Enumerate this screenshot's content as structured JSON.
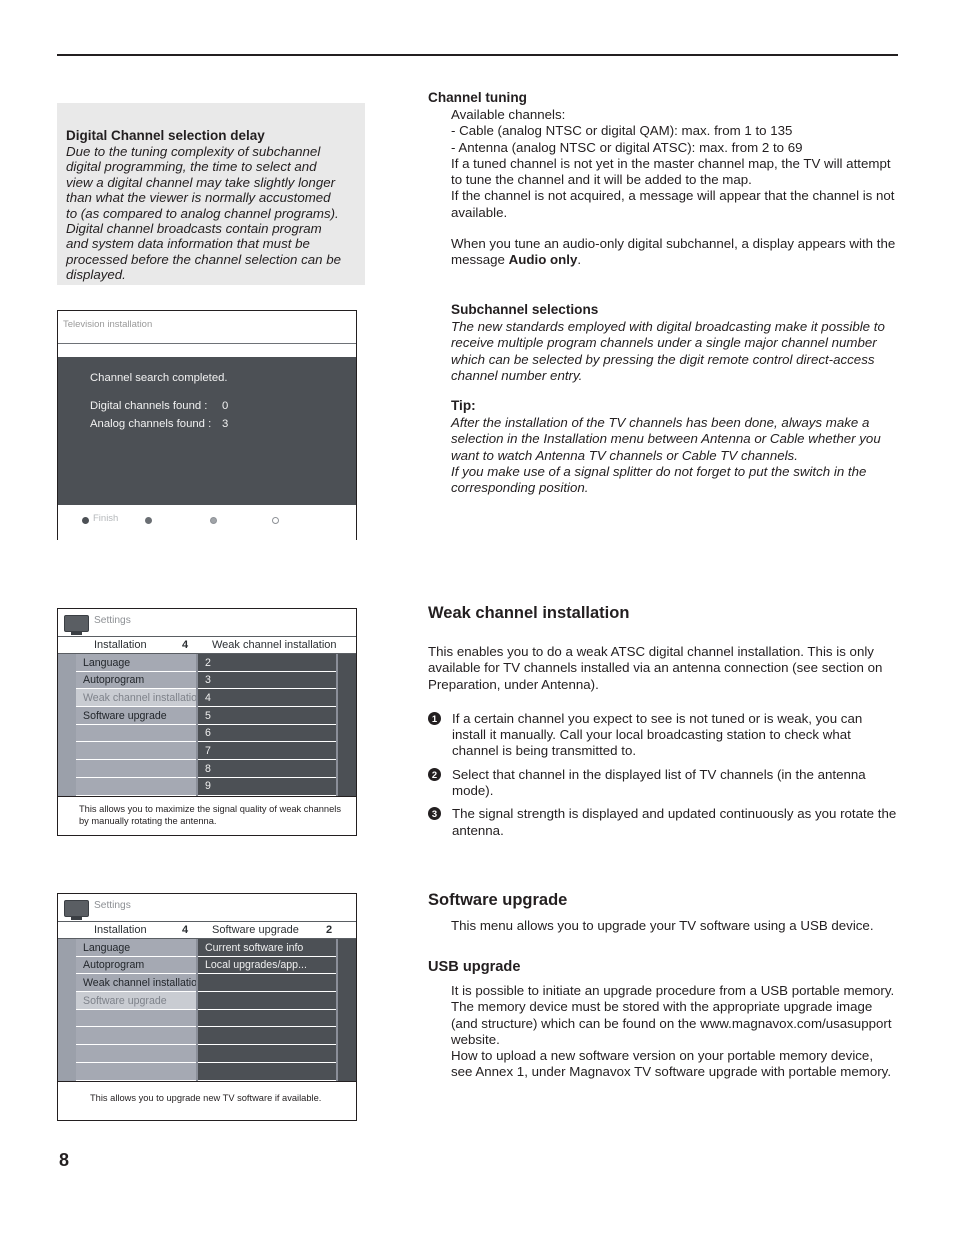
{
  "page": {
    "number": "8"
  },
  "note_box": {
    "title": "Digital Channel selection delay",
    "body": "Due to the tuning complexity of subchannel digital programming, the time to select and view a digital channel may take slightly longer than what the viewer is normally accustomed to (as compared to analog channel programs).\nDigital channel broadcasts contain program and system data information that must be processed before the channel selection can be displayed."
  },
  "illustration_search": {
    "title": "Television installation",
    "message": "Channel search completed.",
    "rows": [
      {
        "label": "Digital channels found :",
        "value": "0"
      },
      {
        "label": "Analog channels found :",
        "value": "3"
      }
    ],
    "footer_label": "Finish"
  },
  "illustration_weak": {
    "settings_label": "Settings",
    "header_left": "Installation",
    "header_left_num": "4",
    "header_right": "Weak channel installation",
    "header_right_num": "",
    "left_items": [
      "Language",
      "Autoprogram",
      "Weak channel installation",
      "Software upgrade",
      "",
      "",
      "",
      ""
    ],
    "selected_left_index": 2,
    "right_items": [
      "2",
      "3",
      "4",
      "5",
      "6",
      "7",
      "8",
      "9"
    ],
    "description": "This allows you to maximize the signal quality of weak channels by manually rotating the antenna."
  },
  "illustration_software": {
    "settings_label": "Settings",
    "header_left": "Installation",
    "header_left_num": "4",
    "header_right": "Software upgrade",
    "header_right_num": "2",
    "left_items": [
      "Language",
      "Autoprogram",
      "Weak channel installation",
      "Software upgrade",
      "",
      "",
      "",
      ""
    ],
    "selected_left_index": 3,
    "right_items": [
      "Current software info",
      "Local upgrades/app...",
      "",
      "",
      "",
      "",
      "",
      ""
    ],
    "description": "This allows you to upgrade new TV software if available."
  },
  "channel_tuning": {
    "title": "Channel tuning",
    "line1": "Available channels:",
    "line2": "- Cable (analog NTSC or digital QAM): max. from 1 to 135",
    "line3": "- Antenna (analog NTSC or digital ATSC): max. from 2 to 69",
    "line4": "If a tuned channel is not yet in the master channel map, the TV will attempt to tune the channel and it will be added to the map.",
    "line5": "If the channel is not acquired, a message will appear that the channel is not available.",
    "line6_pre": "When you tune an audio-only digital subchannel, a display appears with the message ",
    "line6_bold": "Audio only",
    "line6_post": "."
  },
  "subchannel": {
    "title": "Subchannel selections",
    "body": "The new standards employed with digital broadcasting make it possible to receive multiple program channels under a single major channel number which can be selected by pressing the digit remote control direct-access channel number entry."
  },
  "tip": {
    "title": "Tip:",
    "body1": "After the installation of the TV channels has been done, always make a selection in the Installation menu between Antenna or Cable whether you want to watch Antenna TV channels or Cable TV channels.",
    "body2": "If you make use of a signal splitter do not forget to put the switch in the corresponding position."
  },
  "weak_channel": {
    "title": "Weak channel installation",
    "intro": "This enables you to do a weak ATSC digital channel installation. This is only available for TV channels installed via an antenna connection (see section on Preparation, under Antenna).",
    "steps": [
      {
        "num": "1",
        "text": "If a certain channel you expect to see is not tuned or is weak, you can install it manually. Call your local broadcasting station to check what channel is being transmitted to."
      },
      {
        "num": "2",
        "text": "Select that channel in the displayed list of TV channels (in the antenna mode)."
      },
      {
        "num": "3",
        "text": "The signal strength is displayed and updated continuously as you rotate the antenna."
      }
    ]
  },
  "software_upgrade": {
    "title": "Software upgrade",
    "body": "This menu allows you to upgrade your TV software using a USB device."
  },
  "usb_upgrade": {
    "title": "USB upgrade",
    "body1": "It is possible to initiate an upgrade procedure from a USB portable memory. The memory device must be stored with the appropriate upgrade image (and structure) which can be found on the www.magnavox.com/usasupport website.",
    "body2": "How to upload a new software version on your portable memory device, see Annex 1, under Magnavox TV software upgrade with portable memory."
  },
  "colors": {
    "ink": "#231f20",
    "note_bg": "#e9e9e9",
    "tv_screen": "#4c5055",
    "menu_left": "#a5a9b3",
    "menu_left_selected": "#c9ccd2"
  }
}
